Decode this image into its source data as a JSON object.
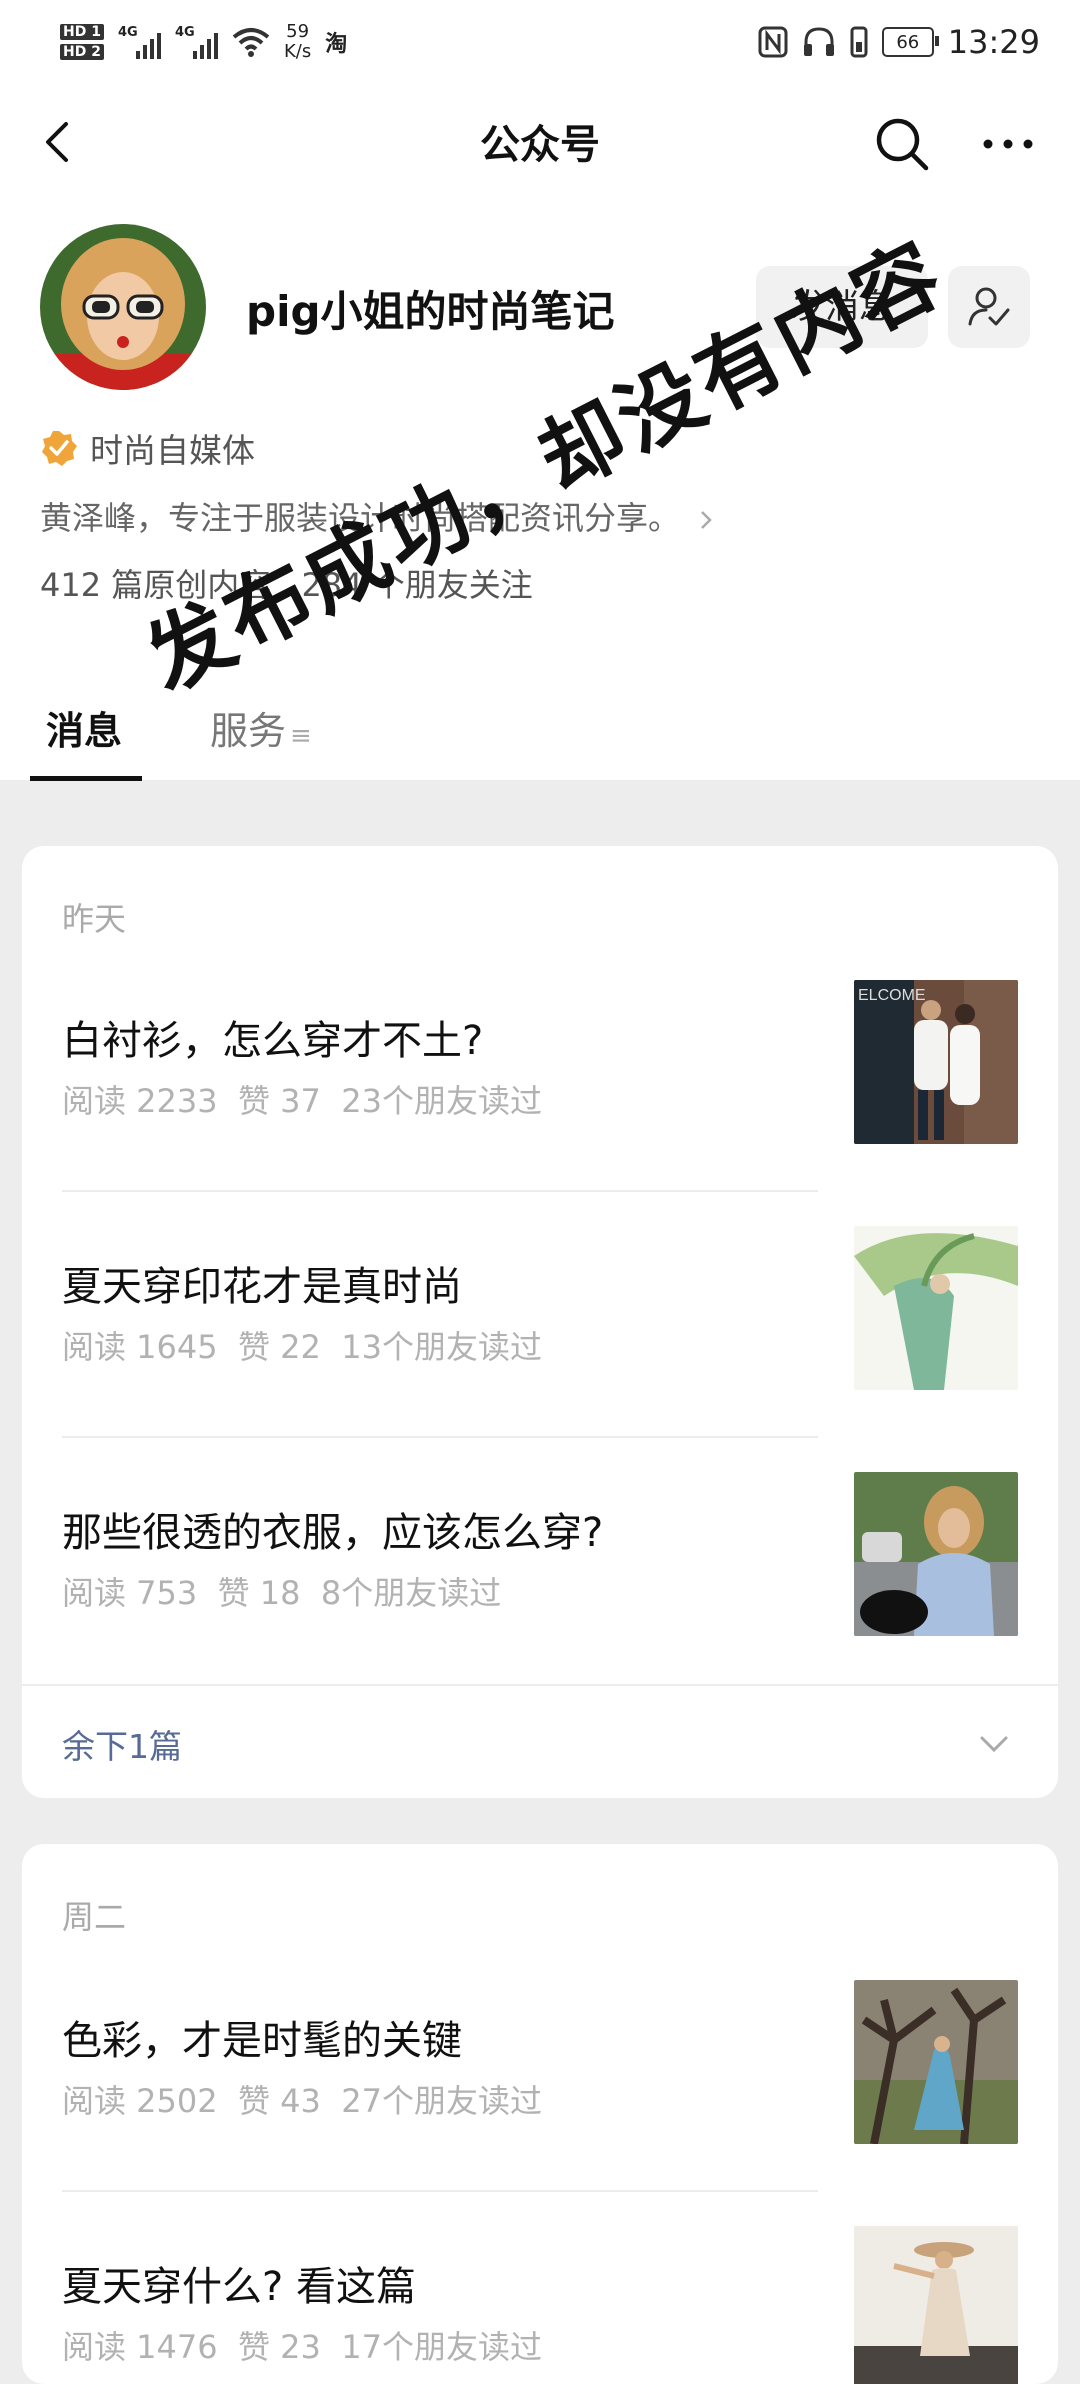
{
  "status_bar": {
    "hd1": "HD 1",
    "hd2": "HD 2",
    "net1": "4G",
    "net2": "4G",
    "speed_value": "59",
    "speed_unit": "K/s",
    "app_badge": "淘",
    "battery": "66",
    "time": "13:29"
  },
  "nav": {
    "title": "公众号"
  },
  "profile": {
    "name": "pig小姐的时尚笔记",
    "message_button": "发消息",
    "verified_label": "时尚自媒体",
    "description": "黄泽峰，专注于服装设计时尚搭配资讯分享。",
    "original_count": "412 篇原创内容",
    "friends_following": "284 个朋友关注"
  },
  "tabs": [
    {
      "label": "消息"
    },
    {
      "label": "服务"
    }
  ],
  "overlay_text": "发布成功，却没有内容",
  "groups": [
    {
      "date": "昨天",
      "articles": [
        {
          "title": "白衬衫，怎么穿才不土?",
          "reads": "阅读 2233",
          "likes": "赞 37",
          "friends": "23个朋友读过"
        },
        {
          "title": "夏天穿印花才是真时尚",
          "reads": "阅读 1645",
          "likes": "赞 22",
          "friends": "13个朋友读过"
        },
        {
          "title": "那些很透的衣服，应该怎么穿?",
          "reads": "阅读 753",
          "likes": "赞 18",
          "friends": "8个朋友读过"
        }
      ],
      "more_label": "余下1篇"
    },
    {
      "date": "周二",
      "articles": [
        {
          "title": "色彩，才是时髦的关键",
          "reads": "阅读 2502",
          "likes": "赞 43",
          "friends": "27个朋友读过"
        },
        {
          "title": "夏天穿什么? 看这篇",
          "reads": "阅读 1476",
          "likes": "赞 23",
          "friends": "17个朋友读过"
        }
      ]
    }
  ],
  "colors": {
    "link": "#576b95",
    "verified_badge": "#f0a53a",
    "background": "#ededed"
  },
  "icons": [
    "back-icon",
    "search-icon",
    "more-icon",
    "follow-user-icon",
    "verified-badge-icon",
    "chevron-right-icon",
    "chevron-down-icon",
    "menu-icon"
  ]
}
